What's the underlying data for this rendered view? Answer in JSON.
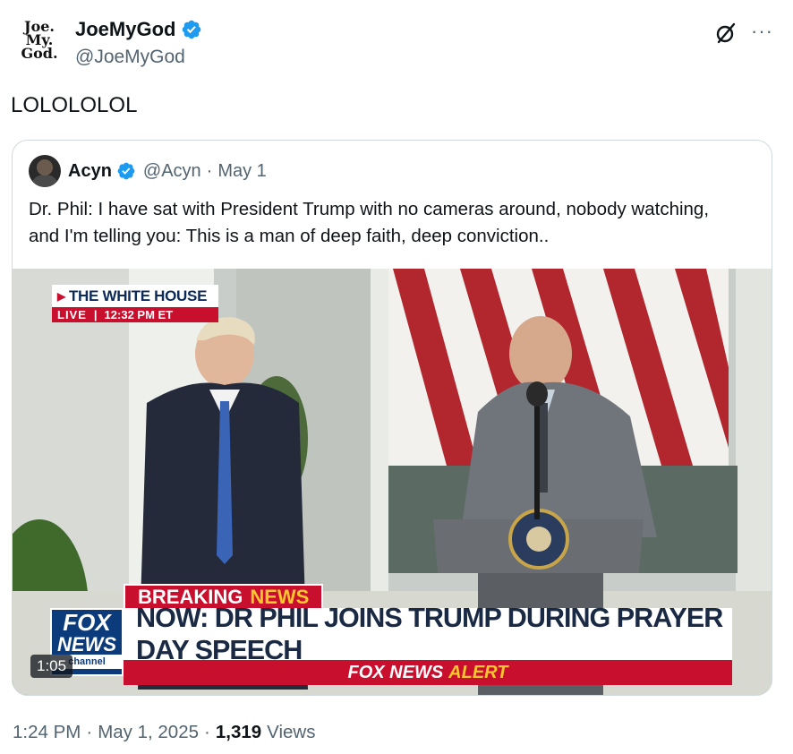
{
  "author": {
    "logo_lines": [
      "Joe.",
      "My.",
      "God."
    ],
    "display_name": "JoeMyGod",
    "handle": "@JoeMyGod",
    "verified_icon": "verified-badge-icon"
  },
  "actions": {
    "grok_icon": "grok-icon",
    "more_icon": "more-options-icon",
    "more_glyph": "···"
  },
  "tweet": {
    "text": "LOLOLOLOL"
  },
  "quoted": {
    "display_name": "Acyn",
    "handle": "@Acyn",
    "separator": "·",
    "date": "May 1",
    "text": "Dr. Phil: I have sat with President Trump with no cameras around, nobody watching, and I'm telling you: This is a man of deep faith, deep conviction..",
    "video": {
      "duration": "1:05",
      "overlay": {
        "location": "THE WHITE HOUSE",
        "live": "LIVE",
        "divider": "|",
        "time": "12:32 PM ET",
        "breaking_1": "BREAKING",
        "breaking_2": "NEWS",
        "headline": "NOW: DR PHIL JOINS TRUMP DURING PRAYER DAY SPEECH",
        "alert_1": "FOX NEWS",
        "alert_2": "ALERT",
        "fox_logo_1": "FOX",
        "fox_logo_2": "NEWS",
        "fox_logo_3": "channel"
      }
    }
  },
  "footer": {
    "time": "1:24 PM",
    "sep1": "·",
    "date": "May 1, 2025",
    "sep2": "·",
    "views_count": "1,319",
    "views_label": "Views"
  },
  "colors": {
    "verified_blue": "#1d9bf0",
    "text_primary": "#0f1419",
    "text_secondary": "#536471",
    "fox_red": "#c8102e",
    "fox_blue": "#0b3b7a",
    "fox_yellow": "#ffc72c"
  }
}
